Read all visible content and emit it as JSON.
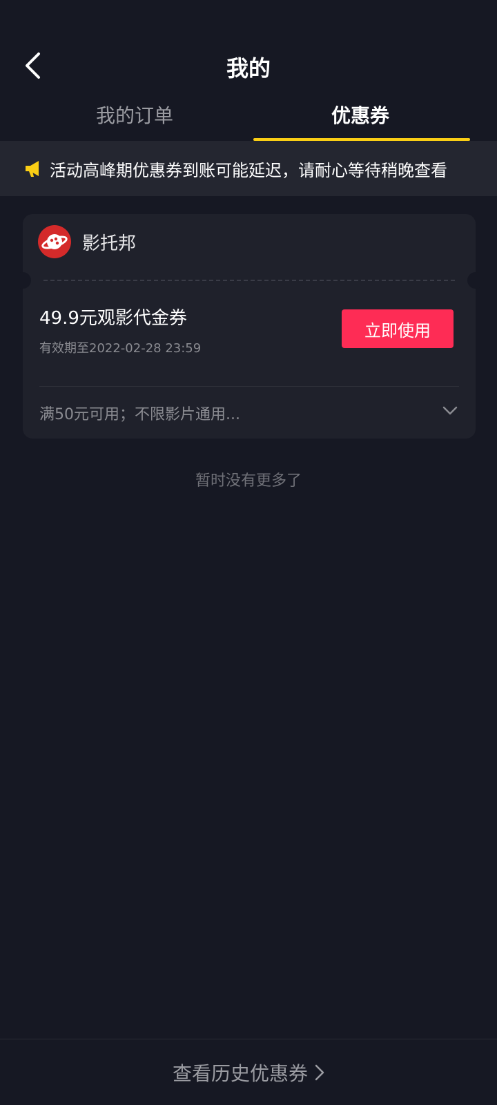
{
  "header": {
    "back_icon": "chevron-left-icon",
    "title": "我的"
  },
  "tabs": [
    {
      "label": "我的订单",
      "active": false
    },
    {
      "label": "优惠券",
      "active": true
    }
  ],
  "notice": {
    "icon": "megaphone-icon",
    "text": "活动高峰期优惠券到账可能延迟，请耐心等待稍晚查看"
  },
  "coupon": {
    "merchant_name": "影托邦",
    "merchant_logo_icon": "planet-logo-icon",
    "name": "49.9元观影代金券",
    "expiry": "有效期至2022-02-28 23:59",
    "use_button_label": "立即使用",
    "rules": "满50元可用；不限影片通用...",
    "expand_icon": "chevron-down-icon"
  },
  "list_end_text": "暂时没有更多了",
  "footer": {
    "history_label": "查看历史优惠券",
    "chevron_icon": "chevron-right-icon"
  },
  "colors": {
    "background": "#161823",
    "accent_yellow": "#face15",
    "primary_button": "#fe2c55",
    "card": "#1f212b"
  }
}
